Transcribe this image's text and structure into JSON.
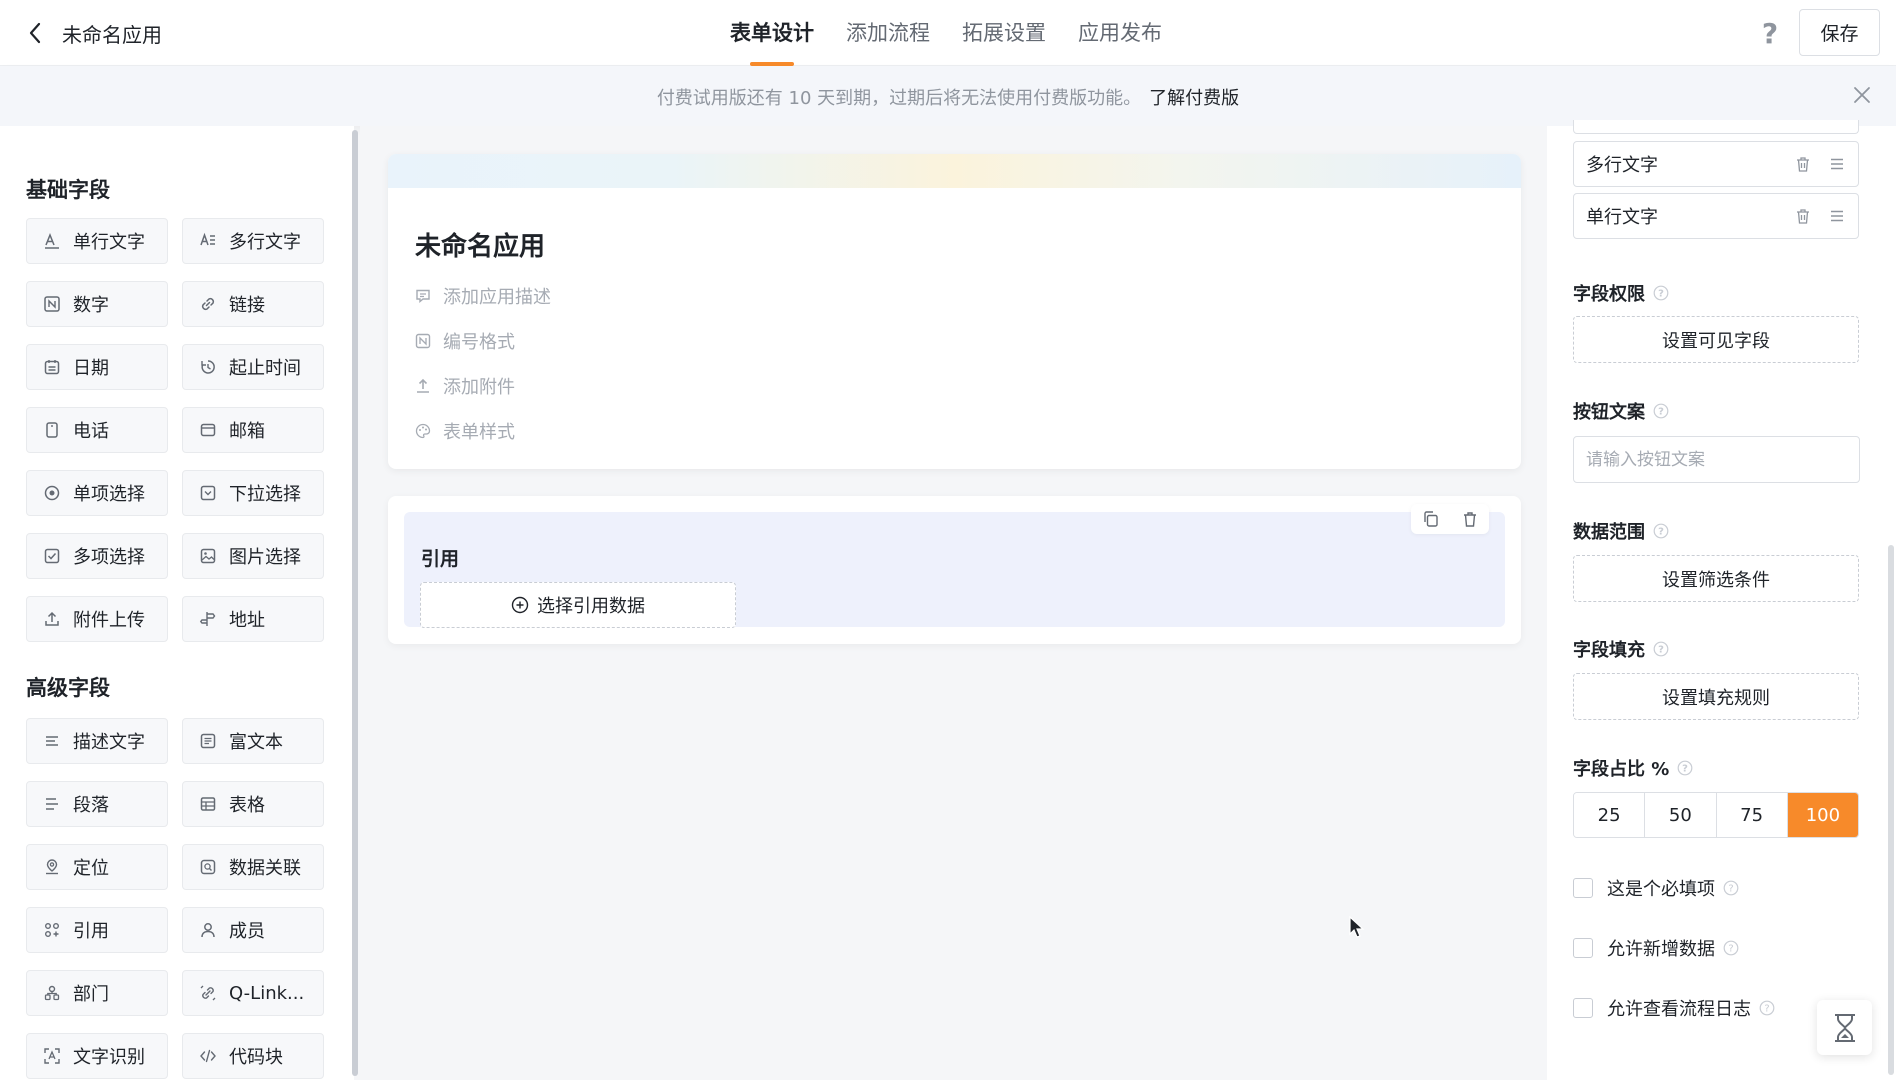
{
  "header": {
    "app_title": "未命名应用",
    "tabs": [
      "表单设计",
      "添加流程",
      "拓展设置",
      "应用发布"
    ],
    "save_label": "保存"
  },
  "notice": {
    "text": "付费试用版还有 10 天到期，过期后将无法使用付费版功能。",
    "link": "了解付费版"
  },
  "left_panel": {
    "basic_title": "基础字段",
    "basic_fields": [
      {
        "label": "单行文字",
        "icon": "single-line-text-icon"
      },
      {
        "label": "多行文字",
        "icon": "multi-line-text-icon"
      },
      {
        "label": "数字",
        "icon": "number-icon"
      },
      {
        "label": "链接",
        "icon": "link-icon"
      },
      {
        "label": "日期",
        "icon": "date-icon"
      },
      {
        "label": "起止时间",
        "icon": "time-range-icon"
      },
      {
        "label": "电话",
        "icon": "phone-icon"
      },
      {
        "label": "邮箱",
        "icon": "email-icon"
      },
      {
        "label": "单项选择",
        "icon": "radio-icon"
      },
      {
        "label": "下拉选择",
        "icon": "dropdown-icon"
      },
      {
        "label": "多项选择",
        "icon": "checkbox-icon"
      },
      {
        "label": "图片选择",
        "icon": "image-icon"
      },
      {
        "label": "附件上传",
        "icon": "upload-icon"
      },
      {
        "label": "地址",
        "icon": "address-icon"
      }
    ],
    "advanced_title": "高级字段",
    "advanced_fields": [
      {
        "label": "描述文字",
        "icon": "description-icon"
      },
      {
        "label": "富文本",
        "icon": "rich-text-icon"
      },
      {
        "label": "段落",
        "icon": "paragraph-icon"
      },
      {
        "label": "表格",
        "icon": "table-icon"
      },
      {
        "label": "定位",
        "icon": "location-icon"
      },
      {
        "label": "数据关联",
        "icon": "data-link-icon"
      },
      {
        "label": "引用",
        "icon": "reference-icon"
      },
      {
        "label": "成员",
        "icon": "member-icon"
      },
      {
        "label": "部门",
        "icon": "department-icon"
      },
      {
        "label": "Q-Link...",
        "icon": "qlink-icon"
      },
      {
        "label": "文字识别",
        "icon": "ocr-icon"
      },
      {
        "label": "代码块",
        "icon": "code-icon"
      }
    ]
  },
  "form": {
    "title": "未命名应用",
    "options": [
      "添加应用描述",
      "编号格式",
      "添加附件",
      "表单样式"
    ]
  },
  "reference_field": {
    "label": "引用",
    "select_label": "选择引用数据"
  },
  "right_panel": {
    "option_rows": [
      "多行文字",
      "单行文字"
    ],
    "field_permission_title": "字段权限",
    "field_permission_button": "设置可见字段",
    "button_text_title": "按钮文案",
    "button_text_placeholder": "请输入按钮文案",
    "data_range_title": "数据范围",
    "data_range_button": "设置筛选条件",
    "field_fill_title": "字段填充",
    "field_fill_button": "设置填充规则",
    "ratio_title": "字段占比 %",
    "ratio_options": [
      "25",
      "50",
      "75",
      "100"
    ],
    "ratio_selected": "100",
    "checkboxes": [
      "这是个必填项",
      "允许新增数据",
      "允许查看流程日志"
    ]
  },
  "colors": {
    "accent": "#f78a2a",
    "text": "#1f2329",
    "muted": "#a6abb3"
  }
}
